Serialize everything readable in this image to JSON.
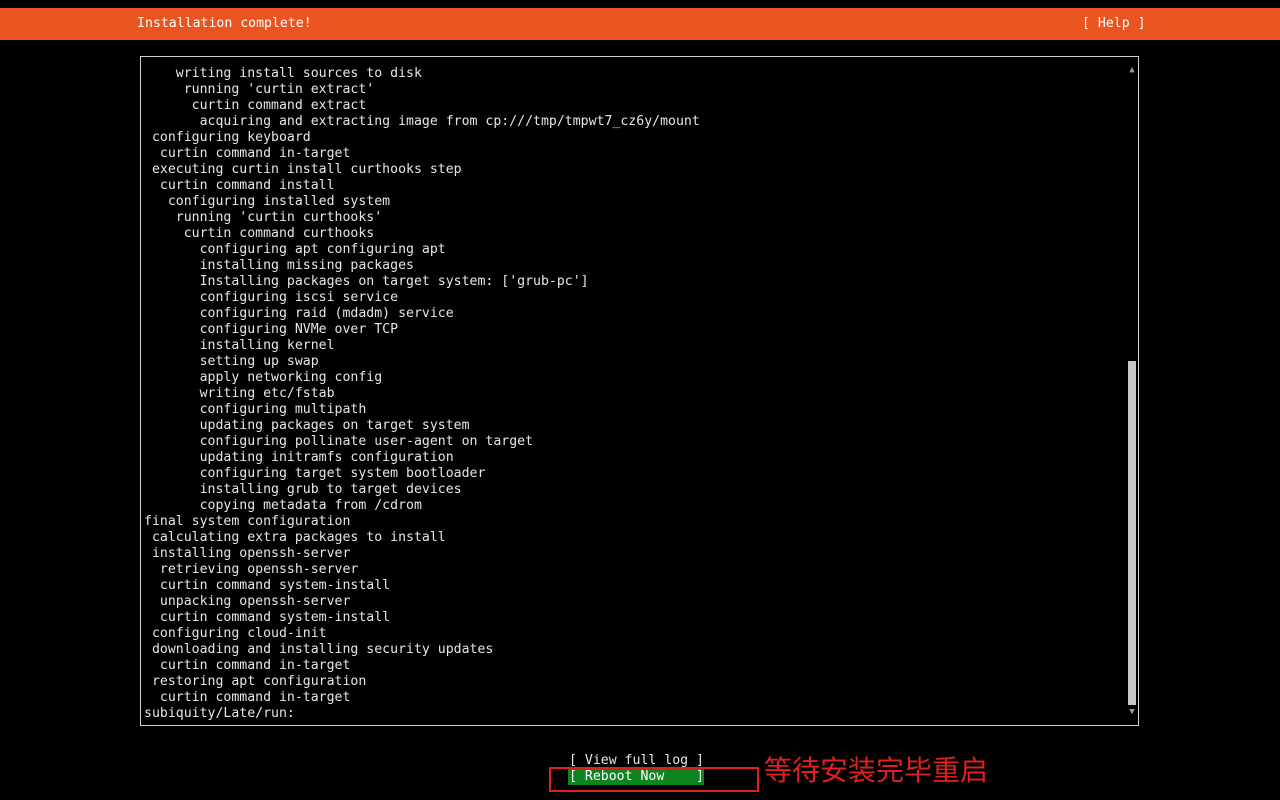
{
  "header": {
    "title": "Installation complete!",
    "help_label": "[ Help ]",
    "color": "#e95420"
  },
  "log": {
    "lines": [
      "    writing install sources to disk",
      "     running 'curtin extract'",
      "      curtin command extract",
      "       acquiring and extracting image from cp:///tmp/tmpwt7_cz6y/mount",
      " configuring keyboard",
      "  curtin command in-target",
      " executing curtin install curthooks step",
      "  curtin command install",
      "   configuring installed system",
      "    running 'curtin curthooks'",
      "     curtin command curthooks",
      "       configuring apt configuring apt",
      "       installing missing packages",
      "       Installing packages on target system: ['grub-pc']",
      "       configuring iscsi service",
      "       configuring raid (mdadm) service",
      "       configuring NVMe over TCP",
      "       installing kernel",
      "       setting up swap",
      "       apply networking config",
      "       writing etc/fstab",
      "       configuring multipath",
      "       updating packages on target system",
      "       configuring pollinate user-agent on target",
      "       updating initramfs configuration",
      "       configuring target system bootloader",
      "       installing grub to target devices",
      "       copying metadata from /cdrom",
      "final system configuration",
      " calculating extra packages to install",
      " installing openssh-server",
      "  retrieving openssh-server",
      "  curtin command system-install",
      "  unpacking openssh-server",
      "  curtin command system-install",
      " configuring cloud-init",
      " downloading and installing security updates",
      "  curtin command in-target",
      " restoring apt configuration",
      "  curtin command in-target",
      "subiquity/Late/run:"
    ]
  },
  "scrollbar": {
    "up_icon": "▲",
    "down_icon": "▼"
  },
  "actions": {
    "view_log_label": "[ View full log ]",
    "reboot_label": "[ Reboot Now    ]",
    "reboot_color": "#0e8420"
  },
  "annotation": {
    "text": "等待安装完毕重启",
    "color": "#e02020"
  }
}
